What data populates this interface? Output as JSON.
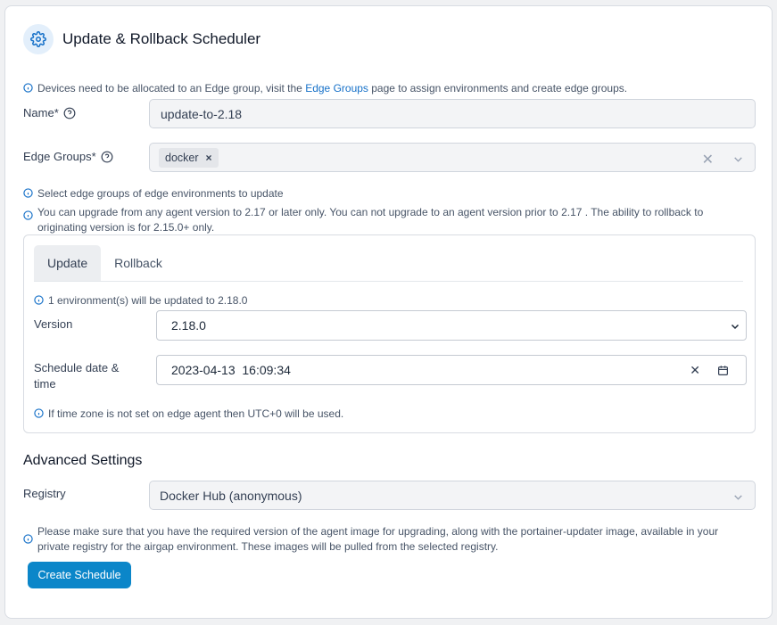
{
  "header": {
    "title": "Update & Rollback Scheduler"
  },
  "notice": {
    "prefix": "Devices need to be allocated to an Edge group, visit the ",
    "link": "Edge Groups",
    "suffix": " page to assign environments and create edge groups."
  },
  "form": {
    "name_label": "Name",
    "name_value": "update-to-2.18",
    "edge_groups_label": "Edge Groups",
    "edge_group_chip": "docker",
    "required_mark": "*",
    "hint_select": "Select edge groups of edge environments to update",
    "hint_upgrade": "You can upgrade from any agent version to 2.17 or later only. You can not upgrade to an agent version prior to 2.17 . The ability to rollback to originating version is for 2.15.0+ only."
  },
  "panel": {
    "tabs": [
      "Update",
      "Rollback"
    ],
    "env_info": "1 environment(s) will be updated to 2.18.0",
    "version_label": "Version",
    "version_value": "2.18.0",
    "schedule_label": "Schedule date & time",
    "schedule_value": "2023-04-13  16:09:34",
    "timezone_info": "If time zone is not set on edge agent then UTC+0 will be used."
  },
  "advanced": {
    "title": "Advanced Settings",
    "registry_label": "Registry",
    "registry_value": "Docker Hub (anonymous)",
    "registry_info": "Please make sure that you have the required version of the agent image for upgrading, along with the portainer-updater image, available in your private registry for the airgap environment. These images will be pulled from the selected registry."
  },
  "actions": {
    "create_label": "Create Schedule"
  },
  "colors": {
    "accent": "#0b86c9",
    "link": "#1570c8",
    "info_icon": "#1570c8"
  }
}
